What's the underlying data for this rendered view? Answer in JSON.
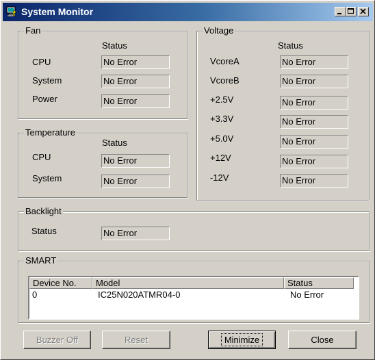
{
  "window": {
    "title": "System Monitor"
  },
  "fan": {
    "legend": "Fan",
    "status_header": "Status",
    "rows": [
      {
        "label": "CPU",
        "value": "No Error"
      },
      {
        "label": "System",
        "value": "No Error"
      },
      {
        "label": "Power",
        "value": "No Error"
      }
    ]
  },
  "temperature": {
    "legend": "Temperature",
    "status_header": "Status",
    "rows": [
      {
        "label": "CPU",
        "value": "No Error"
      },
      {
        "label": "System",
        "value": "No Error"
      }
    ]
  },
  "voltage": {
    "legend": "Voltage",
    "status_header": "Status",
    "rows": [
      {
        "label": "VcoreA",
        "value": "No Error"
      },
      {
        "label": "VcoreB",
        "value": "No Error"
      },
      {
        "label": "+2.5V",
        "value": "No Error"
      },
      {
        "label": "+3.3V",
        "value": "No Error"
      },
      {
        "label": "+5.0V",
        "value": "No Error"
      },
      {
        "label": "+12V",
        "value": "No Error"
      },
      {
        "label": "-12V",
        "value": "No Error"
      }
    ]
  },
  "backlight": {
    "legend": "Backlight",
    "label": "Status",
    "value": "No Error"
  },
  "smart": {
    "legend": "SMART",
    "columns": [
      "Device No.",
      "Model",
      "Status"
    ],
    "rows": [
      {
        "device": "0",
        "model": "IC25N020ATMR04-0",
        "status": "No Error"
      }
    ]
  },
  "buttons": {
    "buzzer_off": "Buzzer Off",
    "reset": "Reset",
    "minimize": "Minimize",
    "close": "Close"
  },
  "icons": {
    "app": "monitor-icon",
    "minimize": "minimize-icon",
    "maximize": "maximize-icon",
    "close": "close-icon"
  }
}
